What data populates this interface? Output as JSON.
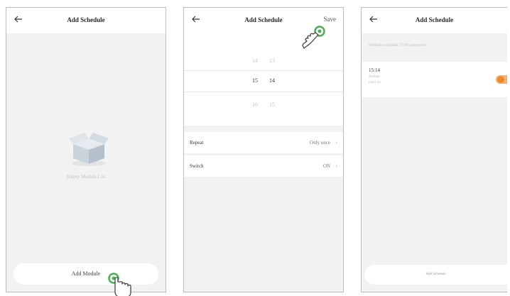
{
  "screens": [
    {
      "title": "Add Schedule",
      "empty_text": "Empty Module List",
      "add_button_label": "Add Module"
    },
    {
      "title": "Add Schedule",
      "save_label": "Save",
      "picker": {
        "above": [
          "14",
          "13"
        ],
        "selected": [
          "15",
          "14"
        ],
        "below": [
          "16",
          "15"
        ]
      },
      "settings": [
        {
          "label": "Repeat",
          "value": "Only once"
        },
        {
          "label": "Switch",
          "value": "ON"
        }
      ]
    },
    {
      "title": "Add Schedule",
      "notice": "Module schedule 15:00 tomorrow",
      "schedule": {
        "time": "15:14",
        "line1": "Module",
        "line2": "Once on"
      },
      "toggle_on": true,
      "accent_color": "#f0892b",
      "bottom_label": "Add Schedule"
    }
  ],
  "icons": {
    "back": "back-arrow-icon",
    "empty": "empty-box-icon",
    "tap": "hand-tap-icon",
    "chevron": "chevron-right-icon"
  },
  "tap_color": "#4caf50"
}
